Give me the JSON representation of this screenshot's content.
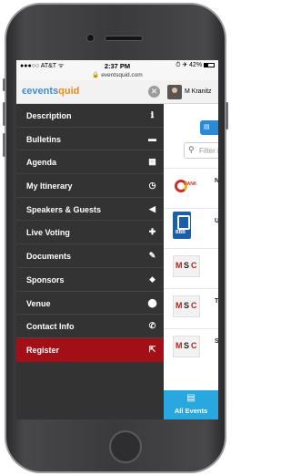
{
  "status_bar": {
    "carrier": "●●●○○ AT&T ᯤ",
    "time": "2:37 PM",
    "right": "⏱ ✈ 42%",
    "url": "eventsquid.com"
  },
  "menu": {
    "logo_main": "events",
    "logo_accent": "quid",
    "close_glyph": "✕",
    "items": [
      {
        "label": "Description",
        "icon": "info-icon",
        "glyph": "ℹ"
      },
      {
        "label": "Bulletins",
        "icon": "chat-bubble-icon",
        "glyph": "▬"
      },
      {
        "label": "Agenda",
        "icon": "calendar-icon",
        "glyph": "▦"
      },
      {
        "label": "My Itinerary",
        "icon": "clock-icon",
        "glyph": "◷"
      },
      {
        "label": "Speakers & Guests",
        "icon": "speaker-icon",
        "glyph": "◀"
      },
      {
        "label": "Live Voting",
        "icon": "plus-icon",
        "glyph": "✚"
      },
      {
        "label": "Documents",
        "icon": "pencil-icon",
        "glyph": "✎"
      },
      {
        "label": "Sponsors",
        "icon": "tag-icon",
        "glyph": "⬥"
      },
      {
        "label": "Venue",
        "icon": "map-pin-icon",
        "glyph": "⬤"
      },
      {
        "label": "Contact Info",
        "icon": "phone-icon",
        "glyph": "✆"
      },
      {
        "label": "Register",
        "icon": "external-link-icon",
        "glyph": "⇱"
      }
    ]
  },
  "content": {
    "user_name": "M Kranitz",
    "filter_placeholder": "Filter ite",
    "filter_glyph": "⚲",
    "blue_button_glyph": "▤",
    "row_letters": [
      "N",
      "U",
      "",
      "T",
      "S"
    ],
    "rank_text": "RANK",
    "bbb_text": "BBB",
    "msc_text": [
      "M",
      "S",
      "C"
    ],
    "all_events_label": "All Events",
    "all_events_glyph": "▤"
  },
  "colors": {
    "menu_bg": "#333333",
    "register_bg": "#a30f16",
    "all_events_bg": "#29a8e0",
    "logo_blue": "#3b8ed8",
    "logo_orange": "#f08a1c"
  }
}
